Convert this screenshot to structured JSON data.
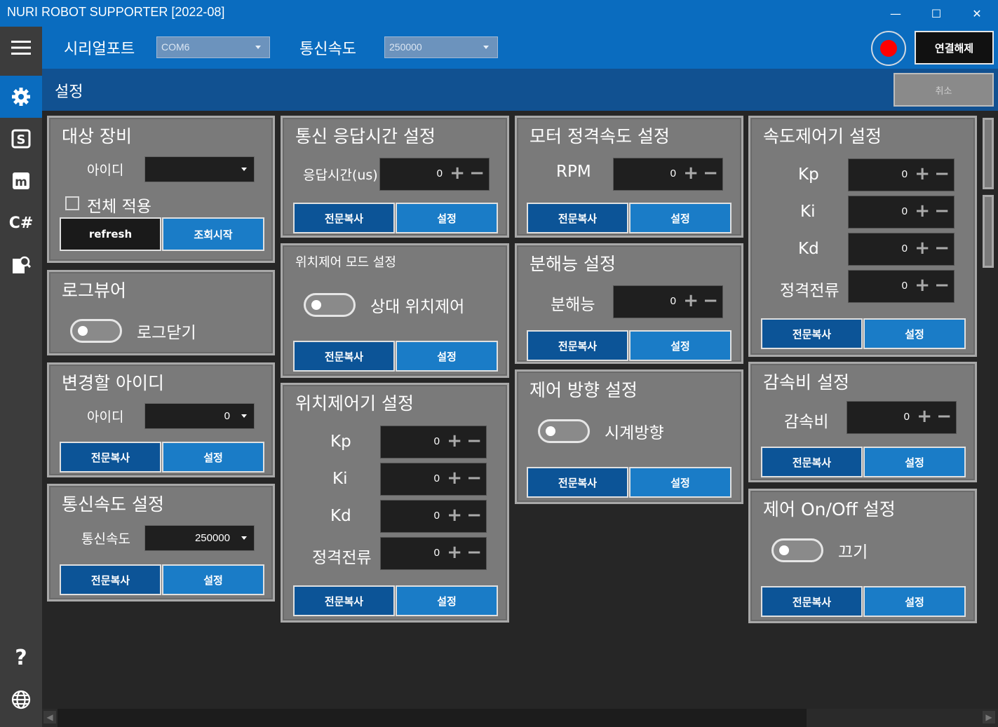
{
  "window": {
    "title": "NURI ROBOT SUPPORTER [2022-08]",
    "minimize": "—",
    "maximize": "☐",
    "close": "✕"
  },
  "topbar": {
    "serial_label": "시리얼포트",
    "serial_value": "COM6",
    "baud_label": "통신속도",
    "baud_value": "250000",
    "disconnect_label": "연결해제"
  },
  "header": {
    "title": "설정",
    "cancel_label": "취소"
  },
  "sidebar": {
    "items": [
      "settings-icon",
      "s-icon",
      "m-icon",
      "csharp-icon",
      "search-doc-icon",
      "help-icon",
      "globe-icon"
    ],
    "csharp_text": "C#",
    "help_text": "?"
  },
  "common": {
    "copy_label": "전문복사",
    "set_label": "설정"
  },
  "panels": {
    "target": {
      "title": "대상 장비",
      "id_label": "아이디",
      "id_value": "",
      "apply_all_label": "전체 적용",
      "refresh_label": "refresh",
      "query_label": "조회시작"
    },
    "logviewer": {
      "title": "로그뷰어",
      "toggle_label": "로그닫기"
    },
    "change_id": {
      "title": "변경할 아이디",
      "id_label": "아이디",
      "id_value": "0"
    },
    "baud": {
      "title": "통신속도 설정",
      "label": "통신속도",
      "value": "250000"
    },
    "resp_time": {
      "title": "통신 응답시간 설정",
      "label": "응답시간(us)",
      "value": "0"
    },
    "pos_mode": {
      "title": "위치제어 모드 설정",
      "toggle_label": "상대 위치제어"
    },
    "pos_ctrl": {
      "title": "위치제어기 설정",
      "rows": [
        {
          "label": "Kp",
          "value": "0"
        },
        {
          "label": "Ki",
          "value": "0"
        },
        {
          "label": "Kd",
          "value": "0"
        },
        {
          "label": "정격전류",
          "value": "0"
        }
      ]
    },
    "motor_rpm": {
      "title": "모터 정격속도 설정",
      "label": "RPM",
      "value": "0"
    },
    "resolution": {
      "title": "분해능 설정",
      "label": "분해능",
      "value": "0"
    },
    "direction": {
      "title": "제어 방향 설정",
      "toggle_label": "시계방향"
    },
    "speed_ctrl": {
      "title": "속도제어기 설정",
      "rows": [
        {
          "label": "Kp",
          "value": "0"
        },
        {
          "label": "Ki",
          "value": "0"
        },
        {
          "label": "Kd",
          "value": "0"
        },
        {
          "label": "정격전류",
          "value": "0"
        }
      ]
    },
    "gear": {
      "title": "감속비 설정",
      "label": "감속비",
      "value": "0"
    },
    "onoff": {
      "title": "제어 On/Off 설정",
      "toggle_label": "끄기"
    }
  },
  "colors": {
    "accent": "#0a6cbf",
    "header": "#115191",
    "panel": "#7a7a7a",
    "record": "#ff0000"
  }
}
